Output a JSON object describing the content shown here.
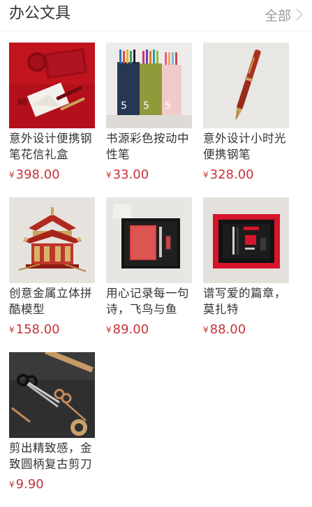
{
  "section": {
    "title": "办公文具",
    "see_all": "全部"
  },
  "currency": "¥",
  "products": [
    {
      "name": "意外设计便携钢笔花信礼盒",
      "price": "398.00",
      "image": "red-pen-gift-box-image"
    },
    {
      "name": "书源彩色按动中性笔",
      "price": "33.00",
      "image": "gel-pen-packs-image"
    },
    {
      "name": "意外设计小时光便携钢笔",
      "price": "328.00",
      "image": "red-fountain-pen-image"
    },
    {
      "name": "创意金属立体拼酷模型",
      "price": "158.00",
      "image": "metal-3d-model-image"
    },
    {
      "name": "用心记录每一句诗，飞鸟与鱼",
      "price": "89.00",
      "image": "notebook-gift-set-image"
    },
    {
      "name": "谱写爱的篇章，莫扎特",
      "price": "88.00",
      "image": "pen-gift-box-image"
    },
    {
      "name": "剪出精致感，金致圆柄复古剪刀",
      "price": "9.90",
      "image": "scissors-set-image"
    }
  ],
  "colors": {
    "price": "#c5333b",
    "title": "#333333",
    "muted": "#999999"
  }
}
